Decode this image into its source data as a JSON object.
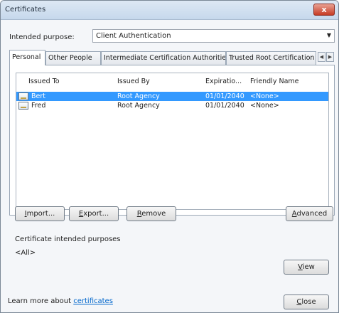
{
  "window": {
    "title": "Certificates",
    "close_glyph": "x"
  },
  "purpose": {
    "label": "Intended purpose:",
    "value": "Client Authentication"
  },
  "tabs": [
    {
      "label": "Personal"
    },
    {
      "label": "Other People"
    },
    {
      "label": "Intermediate Certification Authorities"
    },
    {
      "label": "Trusted Root Certification"
    }
  ],
  "list": {
    "columns": [
      "Issued To",
      "Issued By",
      "Expiratio...",
      "Friendly Name"
    ],
    "rows": [
      {
        "issued_to": "Bert",
        "issued_by": "Root Agency",
        "expiration": "01/01/2040",
        "friendly_name": "<None>",
        "selected": true
      },
      {
        "issued_to": "Fred",
        "issued_by": "Root Agency",
        "expiration": "01/01/2040",
        "friendly_name": "<None>",
        "selected": false
      }
    ]
  },
  "buttons": {
    "import": {
      "accel": "I",
      "rest": "mport..."
    },
    "export": {
      "accel": "E",
      "rest": "xport..."
    },
    "remove": {
      "accel": "R",
      "rest": "emove"
    },
    "advanced": {
      "accel": "A",
      "rest": "dvanced"
    },
    "view": {
      "accel": "V",
      "rest": "iew"
    },
    "close": {
      "accel": "C",
      "rest": "lose"
    }
  },
  "purposes": {
    "label": "Certificate intended purposes",
    "value": "<All>"
  },
  "learn_more": {
    "prefix": "Learn more about ",
    "link": "certificates"
  },
  "colors": {
    "selection": "#3399ff",
    "link": "#0066cc"
  }
}
